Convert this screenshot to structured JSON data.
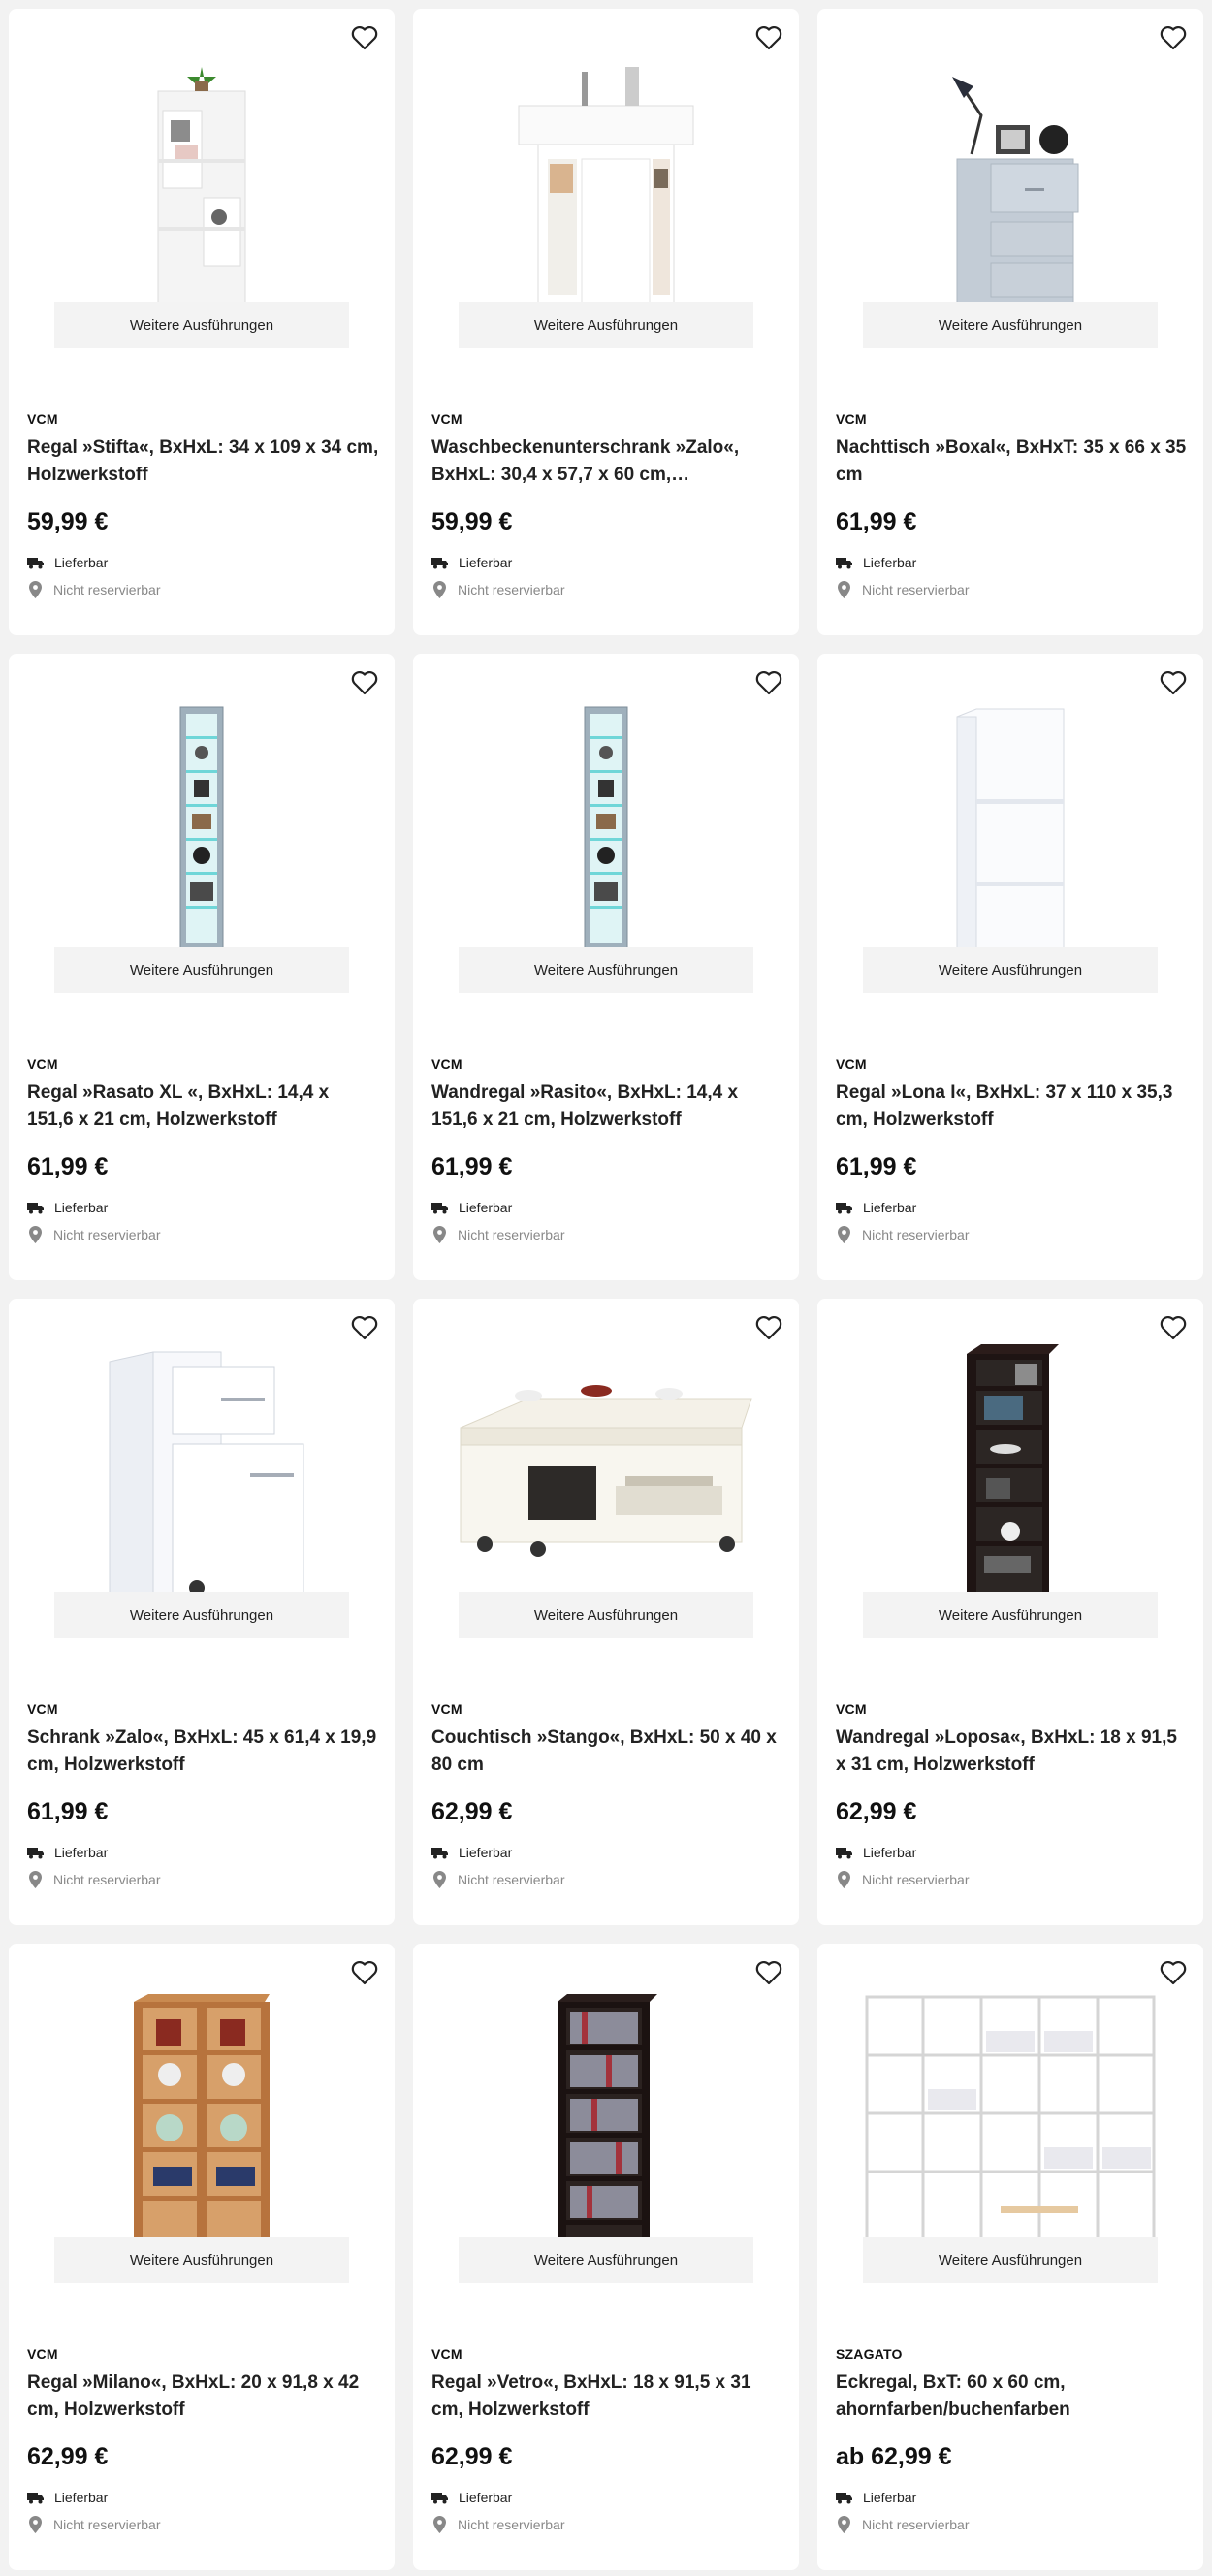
{
  "more_label": "Weitere Ausführungen",
  "delivery_label": "Lieferbar",
  "reserve_label": "Nicht reservierbar",
  "products": [
    {
      "brand": "VCM",
      "title": "Regal »Stifta«, BxHxL: 34 x 109 x 34 cm, Holzwerkstoff",
      "price": "59,99 €",
      "image": "white-shelf-tower-plant"
    },
    {
      "brand": "VCM",
      "title": "Waschbeckenunterschrank »Zalo«, BxHxL: 30,4 x 57,7 x 60 cm,…",
      "price": "59,99 €",
      "image": "sink-cabinet"
    },
    {
      "brand": "VCM",
      "title": "Nachttisch »Boxal«, BxHxT: 35 x 66 x 35 cm",
      "price": "61,99 €",
      "image": "grey-drawer-nightstand-lamp"
    },
    {
      "brand": "VCM",
      "title": "Regal »Rasato XL «, BxHxL: 14,4 x 151,6 x 21 cm, Holzwerkstoff",
      "price": "61,99 €",
      "image": "tall-glass-shelf-led"
    },
    {
      "brand": "VCM",
      "title": "Wandregal »Rasito«, BxHxL: 14,4 x 151,6 x 21 cm, Holzwerkstoff",
      "price": "61,99 €",
      "image": "tall-glass-shelf-led"
    },
    {
      "brand": "VCM",
      "title": "Regal »Lona I«, BxHxL: 37 x 110 x 35,3 cm, Holzwerkstoff",
      "price": "61,99 €",
      "image": "white-open-shelf"
    },
    {
      "brand": "VCM",
      "title": "Schrank »Zalo«, BxHxL: 45 x 61,4 x 19,9 cm, Holzwerkstoff",
      "price": "61,99 €",
      "image": "white-drawer-cabinet"
    },
    {
      "brand": "VCM",
      "title": "Couchtisch »Stango«, BxHxL: 50 x 40 x 80 cm",
      "price": "62,99 €",
      "image": "white-coffee-table"
    },
    {
      "brand": "VCM",
      "title": "Wandregal »Loposa«, BxHxL: 18 x 91,5 x 31 cm, Holzwerkstoff",
      "price": "62,99 €",
      "image": "black-tall-shelf"
    },
    {
      "brand": "VCM",
      "title": "Regal »Milano«, BxHxL: 20 x 91,8 x 42 cm, Holzwerkstoff",
      "price": "62,99 €",
      "image": "beech-media-shelf"
    },
    {
      "brand": "VCM",
      "title": "Regal »Vetro«, BxHxL: 18 x 91,5 x 31 cm, Holzwerkstoff",
      "price": "62,99 €",
      "image": "black-dvd-tower"
    },
    {
      "brand": "SZAGATO",
      "title": "Eckregal, BxT: 60 x 60 cm, ahornfarben/buchenfarben",
      "price": "ab 62,99 €",
      "image": "corner-shelf-system"
    }
  ]
}
